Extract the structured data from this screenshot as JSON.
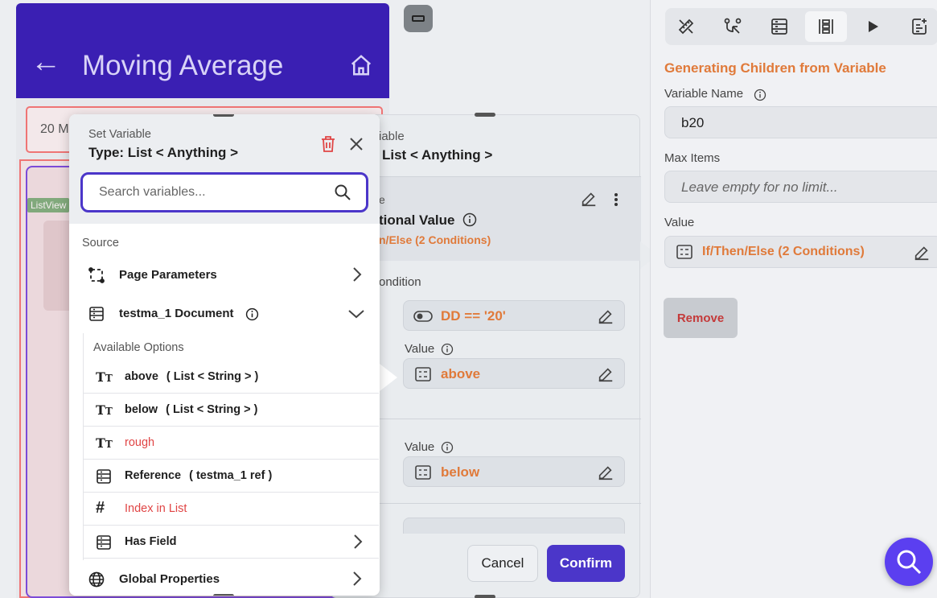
{
  "app_preview": {
    "title": "Moving Average",
    "field_text": "20 M",
    "list_tag": "ListView"
  },
  "conditional_panel": {
    "header_line1": "iable",
    "header_line2": "List < Anything >",
    "section_letter": "e",
    "section_title": "tional Value",
    "section_subtitle": "n/Else (2 Conditions)",
    "condition_label": "ondition",
    "condition_value": "DD  ==  '20'",
    "value_label_1": "Value",
    "value_1": "above",
    "value_label_2": "Value",
    "value_2": "below",
    "cancel_label": "Cancel",
    "confirm_label": "Confirm"
  },
  "set_variable": {
    "title": "Set Variable",
    "type_label": "Type: List < Anything >",
    "search_placeholder": "Search variables...",
    "source_label": "Source",
    "page_parameters": "Page Parameters",
    "document_label": "testma_1 Document",
    "available_options": "Available Options",
    "options": [
      {
        "name": "above",
        "type": "( List < String > )",
        "icon": "text-icon",
        "disabled": false
      },
      {
        "name": "below",
        "type": "( List < String > )",
        "icon": "text-icon",
        "disabled": false
      },
      {
        "name": "rough",
        "type": "",
        "icon": "text-icon",
        "disabled": true
      },
      {
        "name": "Reference",
        "type": "( testma_1 ref )",
        "icon": "document-icon",
        "disabled": false
      },
      {
        "name": "Index in List",
        "type": "",
        "icon": "hash-icon",
        "disabled": true
      },
      {
        "name": "Has Field",
        "type": "",
        "icon": "document-icon",
        "disabled": false
      }
    ],
    "global_properties": "Global Properties"
  },
  "properties_panel": {
    "section_title": "Generating Children from Variable",
    "variable_name_label": "Variable Name",
    "variable_name_value": "b20",
    "max_items_label": "Max Items",
    "max_items_placeholder": "Leave empty for no limit...",
    "value_label": "Value",
    "value_text": "If/Then/Else (2 Conditions)",
    "remove_label": "Remove"
  },
  "colors": {
    "accent": "#4b36c9",
    "header_purple": "#3a1fb3",
    "orange": "#e07a3a",
    "danger": "#e04545"
  }
}
